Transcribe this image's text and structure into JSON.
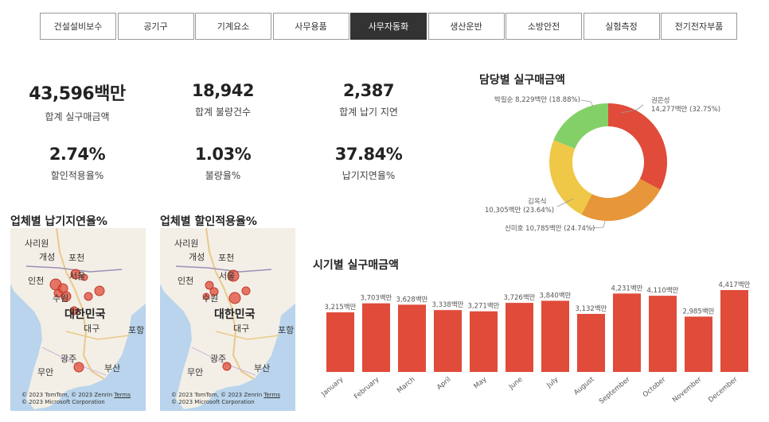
{
  "tabs": [
    {
      "label": "건설설비보수",
      "active": false
    },
    {
      "label": "공기구",
      "active": false
    },
    {
      "label": "기계요소",
      "active": false
    },
    {
      "label": "사무용품",
      "active": false
    },
    {
      "label": "사무자동화",
      "active": true
    },
    {
      "label": "생산운반",
      "active": false
    },
    {
      "label": "소방안전",
      "active": false
    },
    {
      "label": "실험측정",
      "active": false
    },
    {
      "label": "전기전자부품",
      "active": false
    }
  ],
  "kpis": {
    "sales": {
      "value": "43,596백만",
      "label": "합계 실구매금액"
    },
    "defects": {
      "value": "18,942",
      "label": "합계 불량건수"
    },
    "delays": {
      "value": "2,387",
      "label": "합계 납기 지연"
    },
    "discount_rate": {
      "value": "2.74%",
      "label": "할인적용율%"
    },
    "defect_rate": {
      "value": "1.03%",
      "label": "불량율%"
    },
    "delay_rate": {
      "value": "37.84%",
      "label": "납기지연율%"
    }
  },
  "maps": {
    "delay": {
      "title": "업체별 납기지연율%",
      "labels": {
        "sariwon": "사리원",
        "kaesong": "개성",
        "pocheon": "포천",
        "incheon": "인천",
        "seoul": "서울",
        "suwon": "수원",
        "korea": "대한민국",
        "daegu": "대구",
        "pohang": "포항",
        "gwangju": "광주",
        "busan": "부산",
        "muan": "무안"
      },
      "copyright_line1": "© 2023 TomTom, © 2023 Zenrin",
      "terms": "Terms",
      "copyright_line2": "© 2023 Microsoft Corporation"
    },
    "discount": {
      "title": "업체별 할인적용율%",
      "labels": {
        "sariwon": "사리원",
        "kaesong": "개성",
        "pocheon": "포천",
        "incheon": "인천",
        "seoul": "서울",
        "suwon": "수원",
        "korea": "대한민국",
        "daegu": "대구",
        "pohang": "포항",
        "gwangju": "광주",
        "busan": "부산",
        "muan": "무안"
      },
      "copyright_line1": "© 2023 TomTom, © 2023 Zenrin",
      "terms": "Terms",
      "copyright_line2": "© 2023 Microsoft Corporation"
    }
  },
  "donut": {
    "title": "담당별 실구매금액",
    "slices": [
      {
        "name": "권은성",
        "value": 14277,
        "label": "14,277백만 (32.75%)",
        "color": "#e04b3a"
      },
      {
        "name": "신미호",
        "value": 10785,
        "label": "신미호 10,785백만 (24.74%)",
        "color": "#e8963a"
      },
      {
        "name": "김옥식",
        "value": 10305,
        "label": "10,305백만 (23.64%)",
        "color": "#f0c848"
      },
      {
        "name": "박필순",
        "value": 8229,
        "label": "박필순 8,229백만 (18.88%)",
        "color": "#84d068"
      }
    ]
  },
  "bar_title": "시기별 실구매금액",
  "chart_data": {
    "type": "bar",
    "categories": [
      "January",
      "February",
      "March",
      "April",
      "May",
      "June",
      "July",
      "August",
      "September",
      "October",
      "November",
      "December"
    ],
    "values": [
      3215,
      3703,
      3628,
      3338,
      3271,
      3726,
      3840,
      3132,
      4231,
      4110,
      2985,
      4417
    ],
    "data_labels": [
      "3,215백만",
      "3,703백만",
      "3,628백만",
      "3,338백만",
      "3,271백만",
      "3,726백만",
      "3,840백만",
      "3,132백만",
      "4,231백만",
      "4,110백만",
      "2,985백만",
      "4,417백만"
    ],
    "color": "#e04b3a",
    "ylim": [
      0,
      4417
    ]
  }
}
